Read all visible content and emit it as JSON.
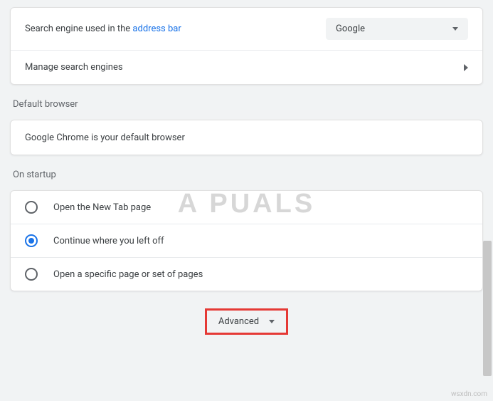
{
  "search_section": {
    "label_prefix": "Search engine used in the ",
    "label_link": "address bar",
    "selected_engine": "Google",
    "manage_label": "Manage search engines"
  },
  "default_browser": {
    "title": "Default browser",
    "status": "Google Chrome is your default browser"
  },
  "startup": {
    "title": "On startup",
    "options": [
      {
        "label": "Open the New Tab page",
        "selected": false
      },
      {
        "label": "Continue where you left off",
        "selected": true
      },
      {
        "label": "Open a specific page or set of pages",
        "selected": false
      }
    ]
  },
  "advanced": {
    "label": "Advanced"
  },
  "watermark": "A  PUALS",
  "sitemark": "wsxdn.com"
}
